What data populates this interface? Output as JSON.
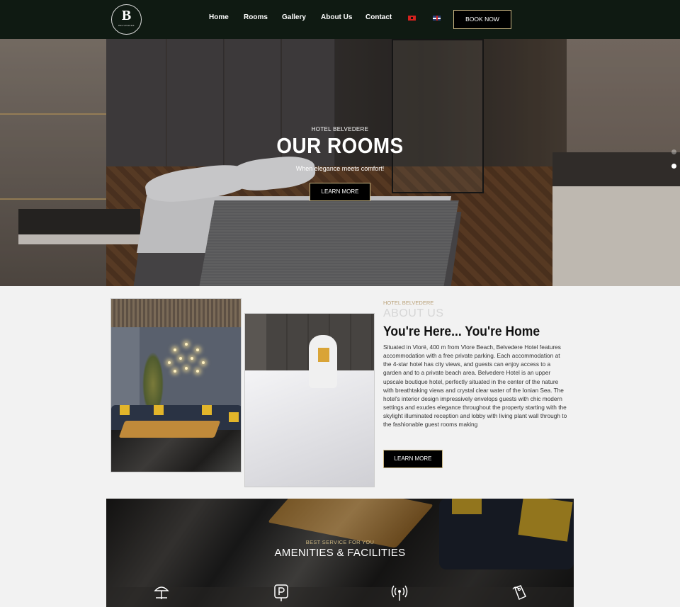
{
  "brand": {
    "logo_mark": "B",
    "logo_text": "BELVEDERE"
  },
  "nav": {
    "items": [
      "Home",
      "Rooms",
      "Gallery",
      "About Us",
      "Contact"
    ],
    "book_label": "BOOK NOW"
  },
  "hero": {
    "kicker": "HOTEL BELVEDERE",
    "title": "OUR ROOMS",
    "subtitle": "When elegance meets comfort!",
    "button": "LEARN MORE"
  },
  "about": {
    "kicker": "HOTEL BELVEDERE",
    "ghost": "ABOUT US",
    "title": "You're Here... You're Home",
    "body": "Situated in Vlorë, 400 m from Vlore Beach, Belvedere Hotel features accommodation with a free private parking. Each accommodation at the 4-star hotel has city views, and guests can enjoy access to a garden and to a private beach area. Belvedere Hotel is an upper upscale boutique hotel, perfectly situated in the center of the nature with breathtaking views and crystal clear water of the Ionian Sea. The hotel's interior design impressively envelops guests with chic modern settings and exudes elegance throughout the property starting with the skylight illuminated reception and lobby with living plant wall through to the fashionable guest rooms making",
    "button": "LEARN MORE"
  },
  "amenities": {
    "kicker": "BEST SERVICE FOR YOU",
    "title": "AMENITIES & FACILITIES",
    "icons": [
      "beach-umbrella-icon",
      "parking-icon",
      "wifi-icon",
      "luggage-tag-icon"
    ]
  },
  "colors": {
    "nav_bg": "#0f1a12",
    "accent_gold": "#c9b582",
    "button_bg": "#000000",
    "page_bg": "#f2f2f2"
  }
}
